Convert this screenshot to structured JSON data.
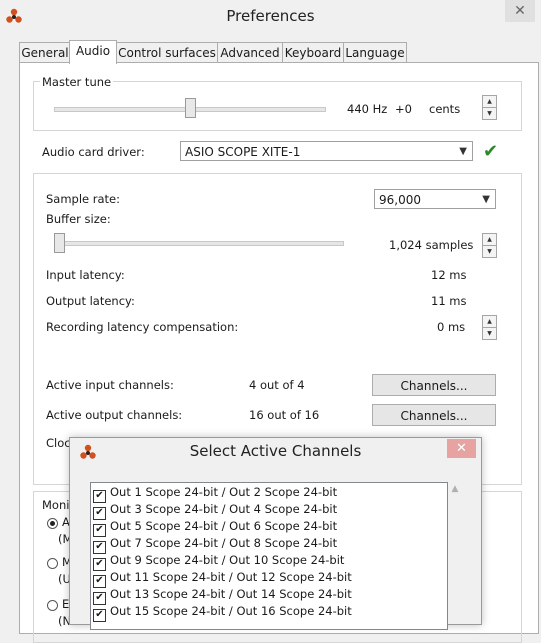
{
  "window": {
    "title": "Preferences",
    "close": "✕"
  },
  "tabs": [
    {
      "label": "General"
    },
    {
      "label": "Audio"
    },
    {
      "label": "Control surfaces"
    },
    {
      "label": "Advanced"
    },
    {
      "label": "Keyboard"
    },
    {
      "label": "Language"
    }
  ],
  "master_tune": {
    "label": "Master tune",
    "hz": "440 Hz",
    "offset": "+0",
    "unit": "cents",
    "slider_fraction": 0.5
  },
  "audio_driver": {
    "label": "Audio card driver:",
    "value": "ASIO SCOPE XITE-1",
    "status": "✔"
  },
  "sample_rate": {
    "label": "Sample rate:",
    "value": "96,000"
  },
  "buffer_size": {
    "label": "Buffer size:",
    "value": "1,024 samples",
    "slider_fraction": 0.0
  },
  "latency": {
    "input_label": "Input latency:",
    "input_value": "12 ms",
    "output_label": "Output latency:",
    "output_value": "11 ms",
    "comp_label": "Recording latency compensation:",
    "comp_value": "0 ms"
  },
  "channels": {
    "input_label": "Active input channels:",
    "input_value": "4 out of 4",
    "input_button": "Channels...",
    "output_label": "Active output channels:",
    "output_value": "16 out of 16",
    "output_button": "Channels...",
    "clock_label": "Cloc"
  },
  "monitoring": {
    "label": "Moni",
    "options": [
      {
        "line1": "A",
        "line2": "(M",
        "selected": true
      },
      {
        "line1": "M",
        "line2": "(U",
        "selected": false
      },
      {
        "line1": "Es",
        "line2": "(N",
        "selected": false
      }
    ]
  },
  "dialog": {
    "title": "Select Active Channels",
    "close": "✕",
    "channels": [
      {
        "label": "Out 1 Scope 24-bit  / Out 2 Scope 24-bit",
        "checked": true
      },
      {
        "label": "Out 3 Scope 24-bit  / Out 4 Scope 24-bit",
        "checked": true
      },
      {
        "label": "Out 5 Scope 24-bit  / Out 6 Scope 24-bit",
        "checked": true
      },
      {
        "label": "Out 7 Scope 24-bit  / Out 8 Scope 24-bit",
        "checked": true
      },
      {
        "label": "Out 9 Scope 24-bit  / Out 10 Scope 24-bit",
        "checked": true
      },
      {
        "label": "Out 11 Scope 24-bit  / Out 12 Scope 24-bit",
        "checked": true
      },
      {
        "label": "Out 13 Scope 24-bit  / Out 14 Scope 24-bit",
        "checked": true
      },
      {
        "label": "Out 15 Scope 24-bit  / Out 16 Scope 24-bit",
        "checked": true
      }
    ]
  }
}
